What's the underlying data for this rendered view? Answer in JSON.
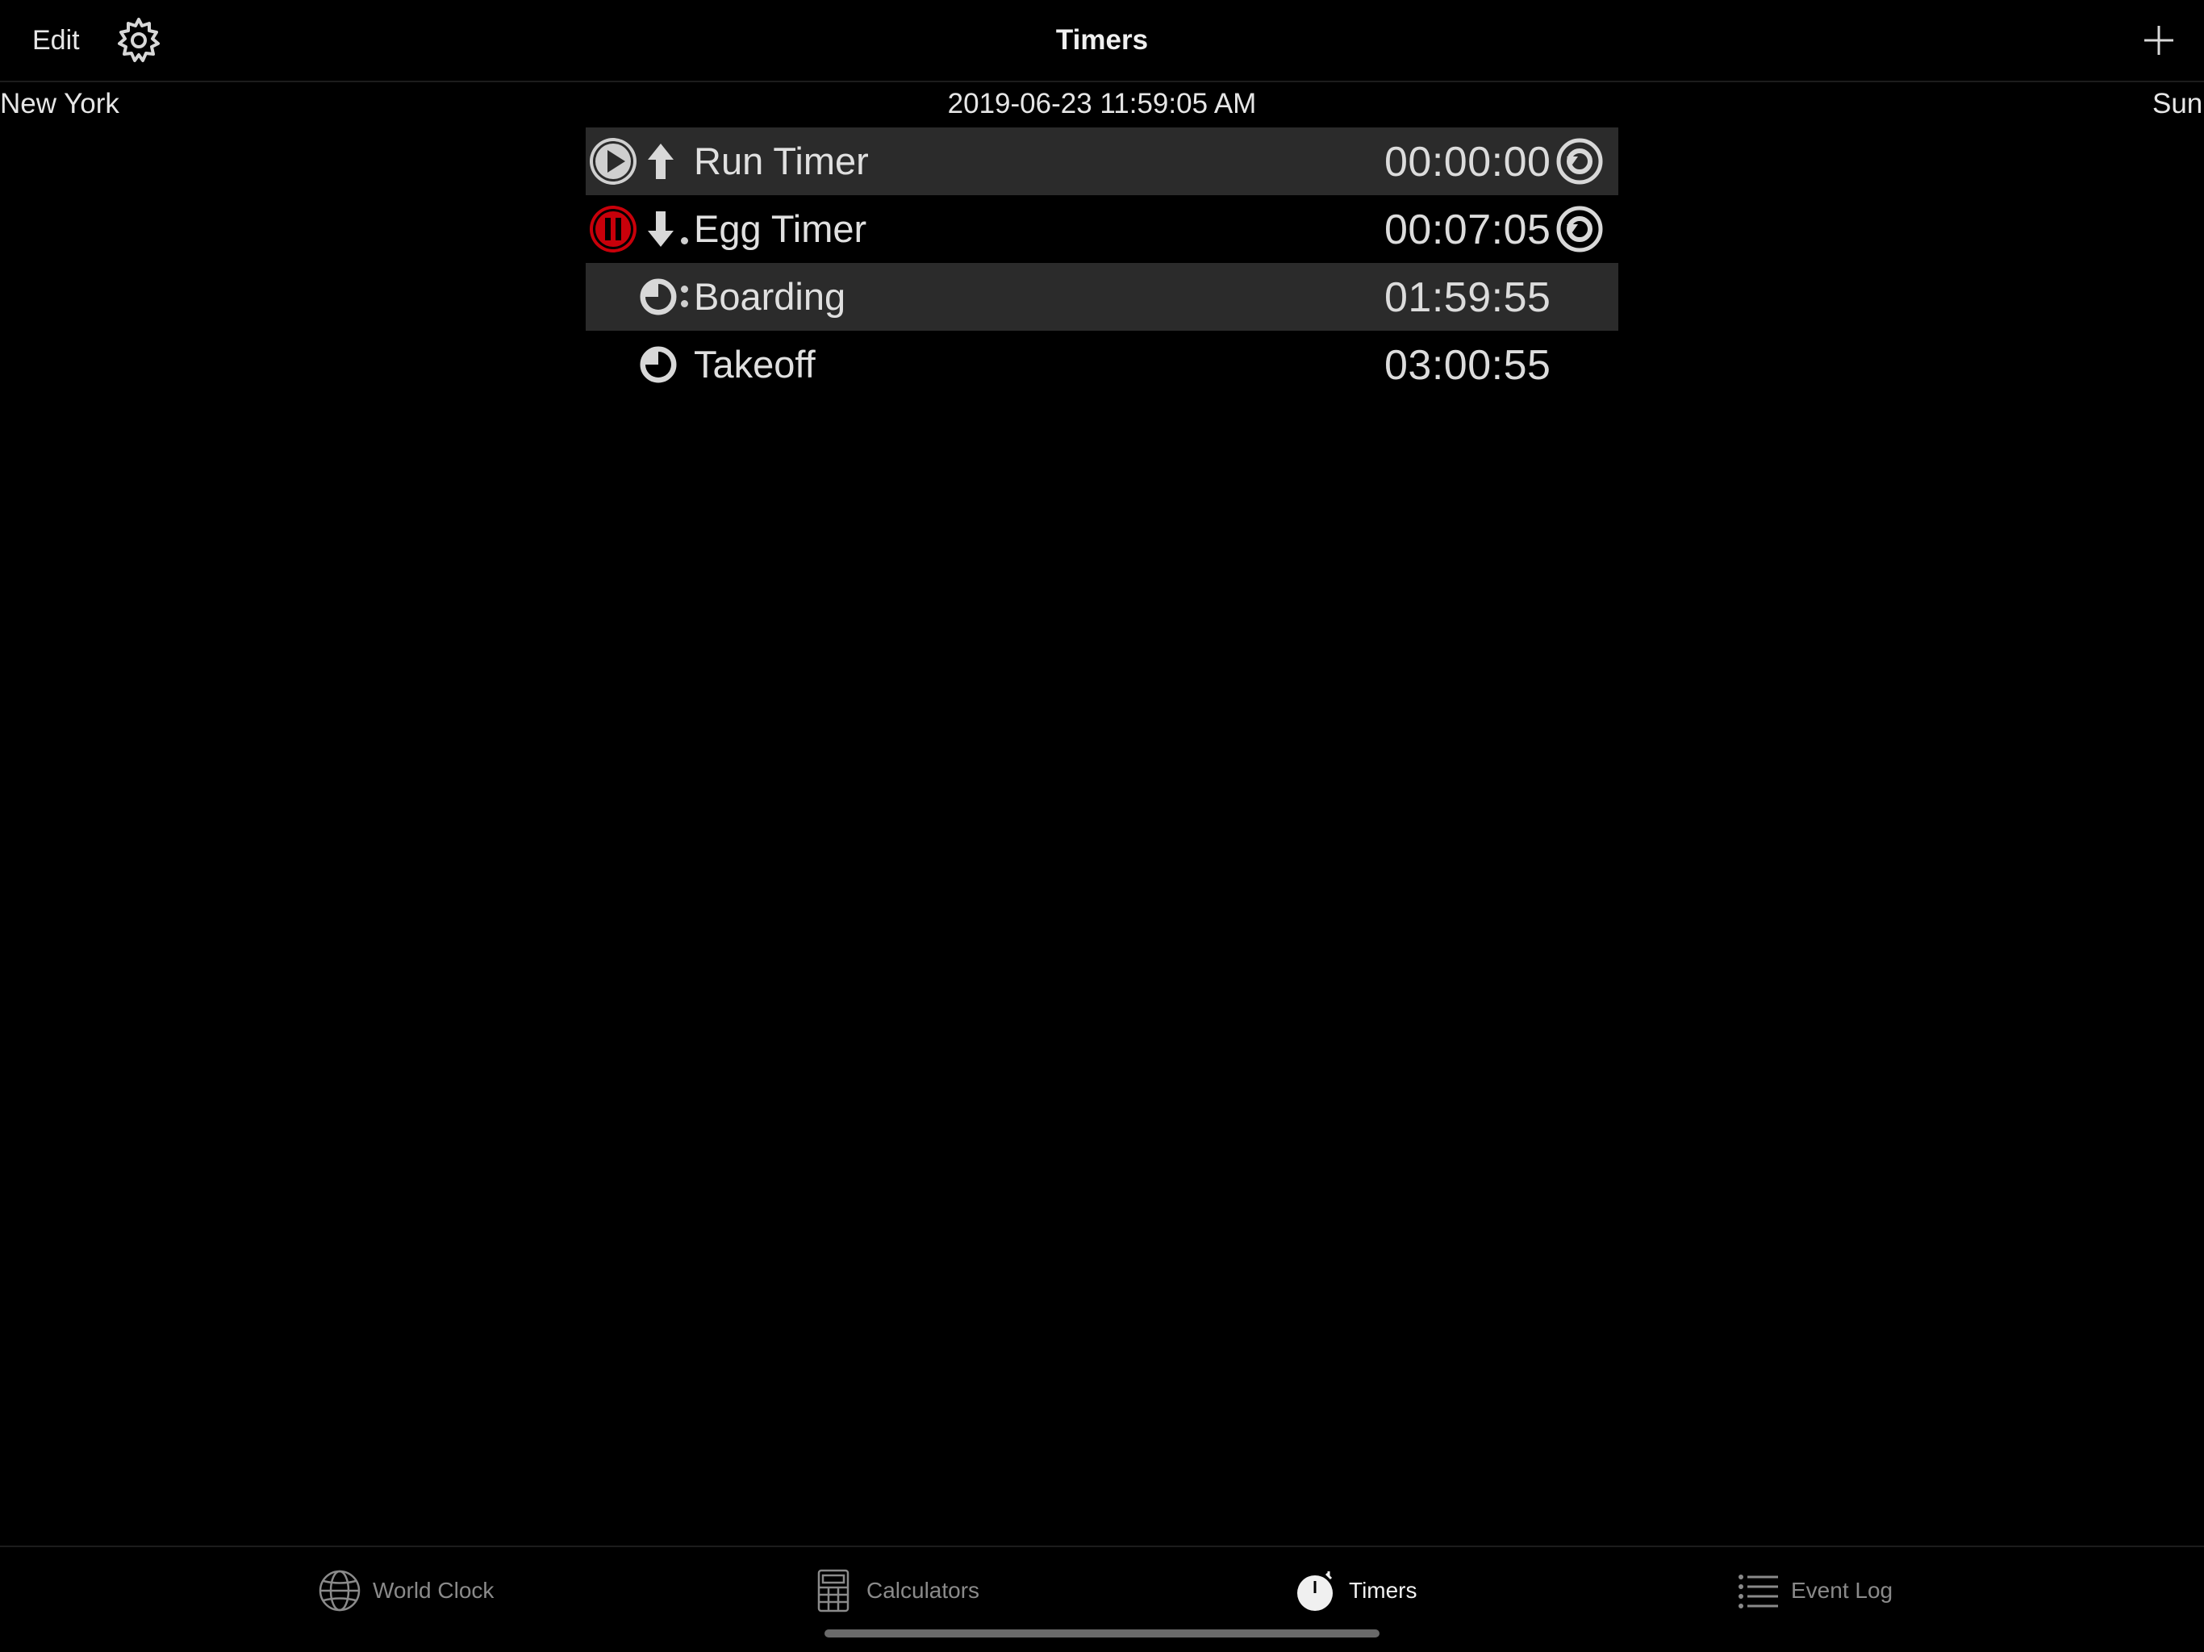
{
  "navbar": {
    "edit_label": "Edit",
    "title": "Timers",
    "settings_icon": "gear-icon",
    "add_icon": "plus-icon"
  },
  "info": {
    "city": "New York",
    "datetime": "2019-06-23 11:59:05 AM",
    "day": "Sun"
  },
  "timers": [
    {
      "name": "Run Timer",
      "time": "00:00:00",
      "state": "stopped",
      "direction": "up",
      "has_reset": true
    },
    {
      "name": "Egg Timer",
      "time": "00:07:05",
      "state": "running",
      "direction": "down",
      "has_reset": true
    },
    {
      "name": "Boarding",
      "time": "01:59:55",
      "type": "clock",
      "has_reset": false
    },
    {
      "name": "Takeoff",
      "time": "03:00:55",
      "type": "clock",
      "has_reset": false
    }
  ],
  "tabs": [
    {
      "label": "World Clock",
      "icon": "globe-icon",
      "active": false
    },
    {
      "label": "Calculators",
      "icon": "calculator-icon",
      "active": false
    },
    {
      "label": "Timers",
      "icon": "stopwatch-icon",
      "active": true
    },
    {
      "label": "Event Log",
      "icon": "list-icon",
      "active": false
    }
  ],
  "colors": {
    "background": "#000000",
    "row_shade": "#2b2b2b",
    "pause_red": "#c8000a",
    "text": "#e6e6e6",
    "inactive_tab": "#8a8a8a"
  }
}
